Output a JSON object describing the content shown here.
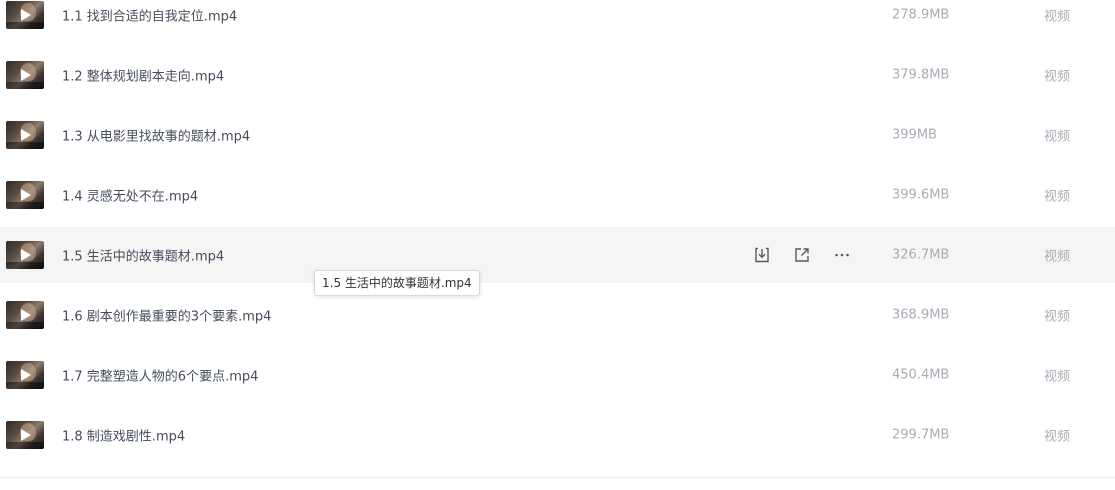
{
  "files": [
    {
      "name": "1.1 找到合适的自我定位.mp4",
      "size": "278.9MB",
      "type": "视频"
    },
    {
      "name": "1.2 整体规划剧本走向.mp4",
      "size": "379.8MB",
      "type": "视频"
    },
    {
      "name": "1.3 从电影里找故事的题材.mp4",
      "size": "399MB",
      "type": "视频"
    },
    {
      "name": "1.4 灵感无处不在.mp4",
      "size": "399.6MB",
      "type": "视频"
    },
    {
      "name": "1.5 生活中的故事题材.mp4",
      "size": "326.7MB",
      "type": "视频"
    },
    {
      "name": "1.6 剧本创作最重要的3个要素.mp4",
      "size": "368.9MB",
      "type": "视频"
    },
    {
      "name": "1.7 完整塑造人物的6个要点.mp4",
      "size": "450.4MB",
      "type": "视频"
    },
    {
      "name": "1.8 制造戏剧性.mp4",
      "size": "299.7MB",
      "type": "视频"
    }
  ],
  "hovered_row": 4,
  "row_actions": {
    "download_icon": "download-icon",
    "share_icon": "share-icon",
    "more_icon": "more-icon"
  },
  "tooltip": {
    "text": "1.5 生活中的故事题材.mp4"
  }
}
